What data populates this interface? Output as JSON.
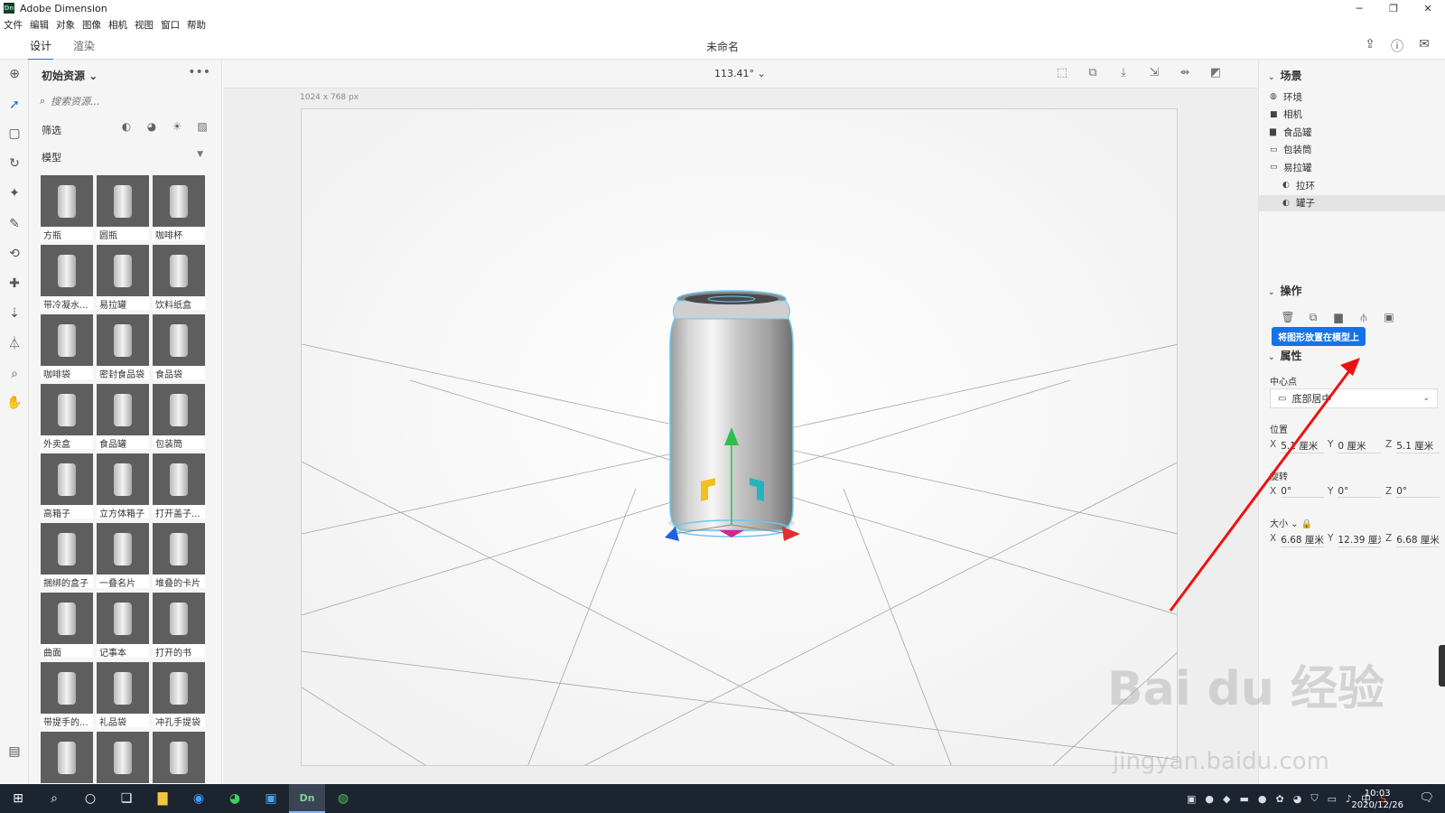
{
  "window": {
    "app_logo": "Dn",
    "title": "Adobe Dimension",
    "controls": [
      "─",
      "❐",
      "✕"
    ]
  },
  "menu": [
    "文件",
    "编辑",
    "对象",
    "图像",
    "相机",
    "视图",
    "窗口",
    "帮助"
  ],
  "tabs": {
    "design": "设计",
    "render": "渲染"
  },
  "document_title": "未命名",
  "assets": {
    "header": "初始资源",
    "search_placeholder": "搜索资源...",
    "filter_label": "筛选",
    "category": "模型",
    "models": [
      "方瓶",
      "圆瓶",
      "咖啡杯",
      "带冷凝水...",
      "易拉罐",
      "饮料纸盒",
      "咖啡袋",
      "密封食品袋",
      "食品袋",
      "外卖盒",
      "食品罐",
      "包装筒",
      "高箱子",
      "立方体箱子",
      "打开盖子...",
      "捆绑的盒子",
      "一叠名片",
      "堆叠的卡片",
      "曲面",
      "记事本",
      "打开的书",
      "带提手的...",
      "礼品袋",
      "冲孔手提袋",
      "",
      "",
      ""
    ]
  },
  "viewport": {
    "zoom": "113.41°",
    "dimensions": "1024 x 768 px"
  },
  "scene": {
    "title": "场景",
    "items": [
      {
        "label": "环境",
        "icon": "globe-icon",
        "level": 0
      },
      {
        "label": "相机",
        "icon": "camera-icon",
        "level": 0
      },
      {
        "label": "食品罐",
        "icon": "folder-icon",
        "level": 0
      },
      {
        "label": "包装筒",
        "icon": "folder-open-icon",
        "level": 0
      },
      {
        "label": "易拉罐",
        "icon": "folder-open-icon",
        "level": 0
      },
      {
        "label": "拉环",
        "icon": "sphere-icon",
        "level": 1
      },
      {
        "label": "罐子",
        "icon": "sphere-icon",
        "level": 1
      }
    ]
  },
  "operations": {
    "title": "操作",
    "tooltip": "将图形放置在模型上"
  },
  "properties": {
    "title": "属性",
    "pivot_label": "中心点",
    "pivot_value": "底部居中",
    "position_label": "位置",
    "position": {
      "x": "5.1 厘米",
      "y": "0 厘米",
      "z": "5.1 厘米"
    },
    "rotation_label": "旋转",
    "rotation": {
      "x": "0°",
      "y": "0°",
      "z": "0°"
    },
    "size_label": "大小",
    "size": {
      "x": "6.68 厘米",
      "y": "12.39 厘米",
      "z": "6.68 厘米"
    }
  },
  "taskbar": {
    "time": "10:03",
    "date": "2020/12/26",
    "ime": "中"
  },
  "watermark": {
    "line1": "Bai du 经验",
    "line2": "jingyan.baidu.com"
  },
  "colors": {
    "accent": "#1473e6",
    "arrow": "#ee1111",
    "taskbar": "#1c2430"
  }
}
